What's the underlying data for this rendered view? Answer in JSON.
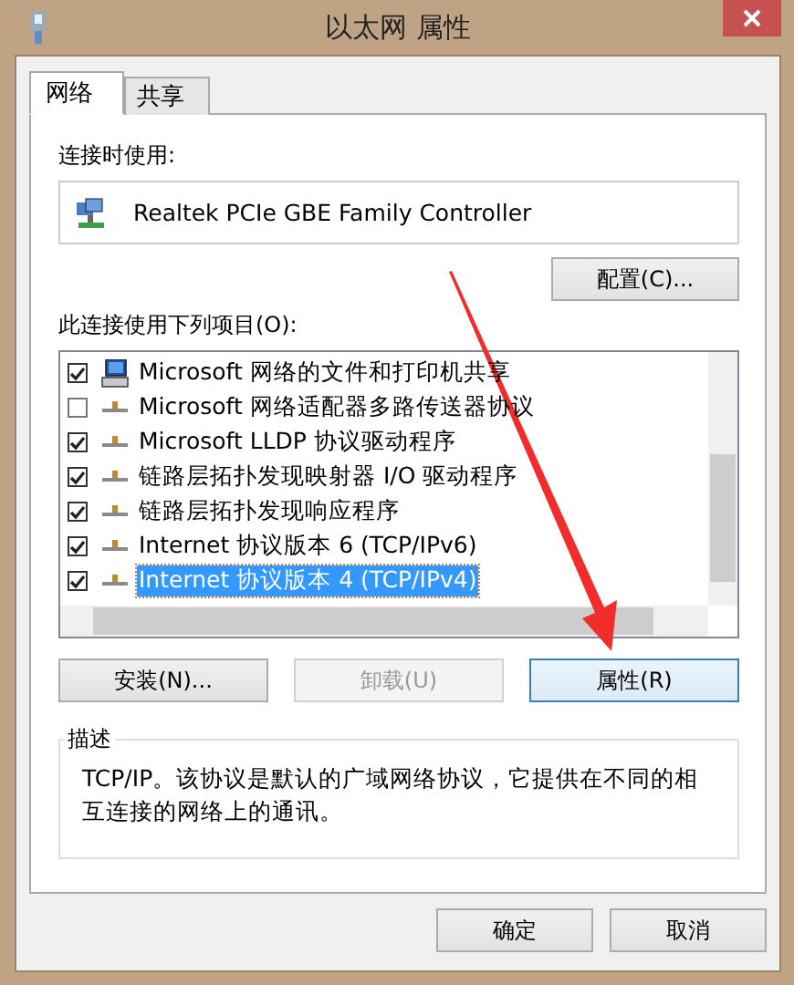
{
  "window": {
    "title": "以太网 属性"
  },
  "tabs": [
    {
      "label": "网络",
      "selected": true
    },
    {
      "label": "共享",
      "selected": false
    }
  ],
  "connect_using": {
    "label": "连接时使用:",
    "adapter": "Realtek PCIe GBE Family Controller",
    "configure_button": "配置(C)..."
  },
  "items_label": "此连接使用下列项目(O):",
  "items": [
    {
      "kind": "service",
      "label": "Microsoft 网络的文件和打印机共享",
      "checked": true,
      "selected": false
    },
    {
      "kind": "protocol",
      "label": "Microsoft 网络适配器多路传送器协议",
      "checked": false,
      "selected": false
    },
    {
      "kind": "protocol",
      "label": "Microsoft LLDP 协议驱动程序",
      "checked": true,
      "selected": false
    },
    {
      "kind": "protocol",
      "label": "链路层拓扑发现映射器 I/O 驱动程序",
      "checked": true,
      "selected": false
    },
    {
      "kind": "protocol",
      "label": "链路层拓扑发现响应程序",
      "checked": true,
      "selected": false
    },
    {
      "kind": "protocol",
      "label": "Internet 协议版本 6 (TCP/IPv6)",
      "checked": true,
      "selected": false
    },
    {
      "kind": "protocol",
      "label": "Internet 协议版本 4 (TCP/IPv4)",
      "checked": true,
      "selected": true
    }
  ],
  "item_buttons": [
    {
      "label": "安装(N)...",
      "disabled": false,
      "focused": false
    },
    {
      "label": "卸载(U)",
      "disabled": true,
      "focused": false
    },
    {
      "label": "属性(R)",
      "disabled": false,
      "focused": true
    }
  ],
  "description": {
    "legend": "描述",
    "text": "TCP/IP。该协议是默认的广域网络协议，它提供在不同的相互连接的网络上的通讯。"
  },
  "dialog_buttons": [
    "确定",
    "取消"
  ]
}
